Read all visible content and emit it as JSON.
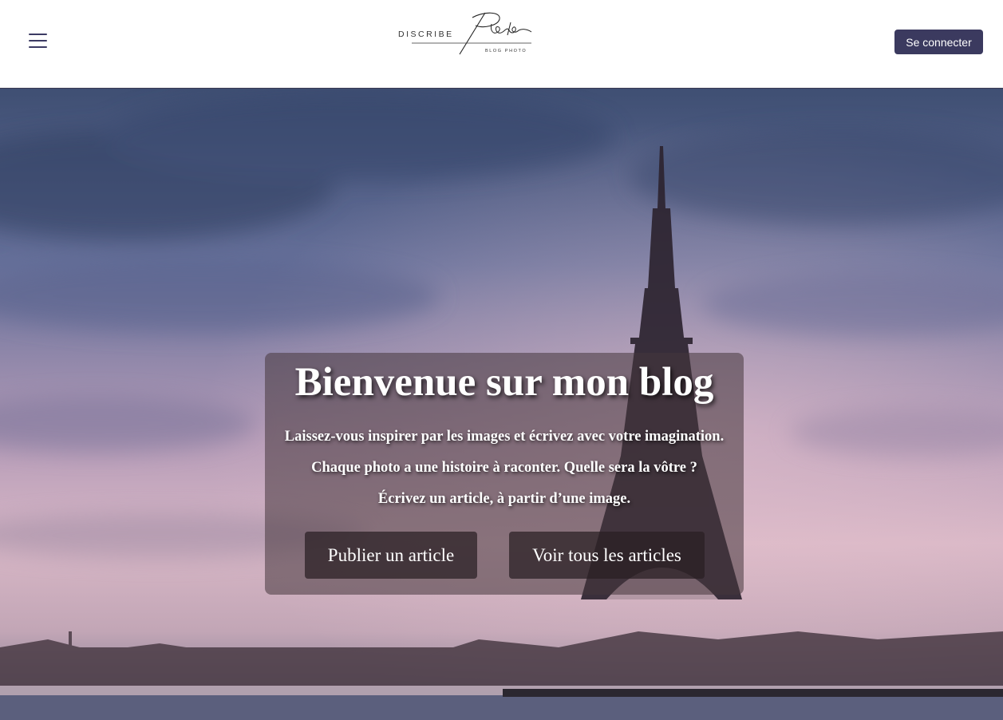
{
  "header": {
    "menu_icon": "hamburger-menu-icon",
    "logo": {
      "brand": "DISCRIBE",
      "script": "Photo",
      "tagline": "BLOG PHOTO"
    },
    "login_label": "Se connecter"
  },
  "hero": {
    "background": "eiffel-tower-paris-sunset-photo",
    "title": "Bienvenue sur mon blog",
    "lines": [
      "Laissez-vous inspirer par les images et écrivez avec votre imagination.",
      "Chaque photo a une histoire à raconter. Quelle sera la vôtre ?",
      "Écrivez un article, à partir d’une image."
    ],
    "buttons": {
      "publish": "Publier un article",
      "view_all": "Voir tous les articles"
    }
  },
  "colors": {
    "accent": "#3b3a5f",
    "header_bg": "#ffffff",
    "text_light": "#ffffff"
  }
}
